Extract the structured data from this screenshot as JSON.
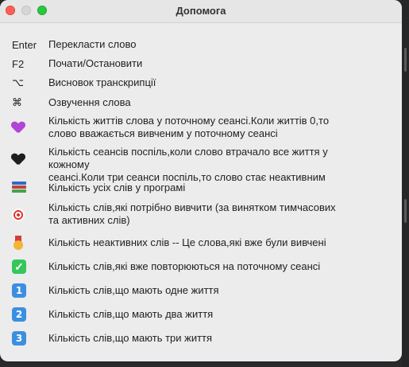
{
  "window": {
    "title": "Допомога"
  },
  "shortcuts": [
    {
      "key": "Enter",
      "desc": "Перекласти слово"
    },
    {
      "key": "F2",
      "desc": "Почати/Остановити"
    },
    {
      "key": "⌥",
      "desc": "Висновок транскрипції"
    },
    {
      "key": "⌘",
      "desc": "Озвучення слова"
    }
  ],
  "legend": [
    {
      "icon": "purple-heart-icon",
      "line1": "Кількість життів слова у поточному сеансі.Коли життів 0,то",
      "line2": "слово вважається вивченим у поточному сеансі"
    },
    {
      "icon": "black-heart-icon",
      "line1": "Кількість сеансів поспіль,коли слово втрачало все життя у кожному",
      "line2": "сеансі.Коли три сеанси поспіль,то слово стає неактивним"
    },
    {
      "icon": "books-icon",
      "line1": "Кількість усіх слів у програмі",
      "line2": ""
    },
    {
      "icon": "target-icon",
      "line1": "Кількість слів,які потрібно вивчити (за винятком тимчасових",
      "line2": "та активних слів)"
    },
    {
      "icon": "medal-icon",
      "line1": "Кількість неактивних слів -- Це слова,які вже були вивчені",
      "line2": ""
    },
    {
      "icon": "check-mark-icon",
      "line1": "Кількість слів,які вже повторюються на поточному сеансі",
      "line2": ""
    },
    {
      "icon": "keycap-one-icon",
      "glyph": "1",
      "line1": "Кількість слів,що мають одне життя",
      "line2": ""
    },
    {
      "icon": "keycap-two-icon",
      "glyph": "2",
      "line1": "Кількість слів,що мають два життя",
      "line2": ""
    },
    {
      "icon": "keycap-three-icon",
      "glyph": "3",
      "line1": "Кількість слів,що мають три життя",
      "line2": ""
    }
  ],
  "colors": {
    "close": "#ff5f57",
    "minimize_inactive": "#d6d6d6",
    "maximize": "#28c840",
    "window_bg": "#ececec",
    "check_green": "#34c759",
    "keycap_blue": "#3b8fe0",
    "purple_heart": "#b145d6"
  }
}
